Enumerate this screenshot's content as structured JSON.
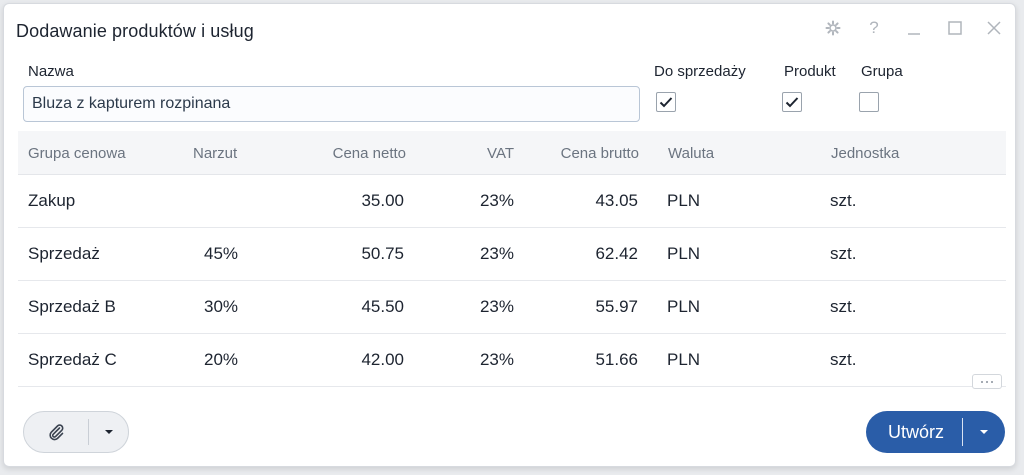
{
  "dialog": {
    "title": "Dodawanie produktów i usług"
  },
  "window_controls": {
    "icons": [
      "gear-icon",
      "help-icon",
      "minimize-icon",
      "maximize-icon",
      "close-icon"
    ],
    "help_glyph": "?"
  },
  "form": {
    "name_label": "Nazwa",
    "name_value": "Bluza z kapturem rozpinana",
    "checkboxes": [
      {
        "label": "Do sprzedaży",
        "checked": true
      },
      {
        "label": "Produkt",
        "checked": true
      },
      {
        "label": "Grupa",
        "checked": false
      }
    ]
  },
  "table": {
    "headers": [
      "Grupa cenowa",
      "Narzut",
      "Cena netto",
      "VAT",
      "Cena brutto",
      "Waluta",
      "Jednostka"
    ],
    "rows": [
      {
        "grupa": "Zakup",
        "narzut": "",
        "netto": "35.00",
        "vat": "23%",
        "brutto": "43.05",
        "waluta": "PLN",
        "jednostka": "szt."
      },
      {
        "grupa": "Sprzedaż",
        "narzut": "45%",
        "netto": "50.75",
        "vat": "23%",
        "brutto": "62.42",
        "waluta": "PLN",
        "jednostka": "szt."
      },
      {
        "grupa": "Sprzedaż B",
        "narzut": "30%",
        "netto": "45.50",
        "vat": "23%",
        "brutto": "55.97",
        "waluta": "PLN",
        "jednostka": "szt."
      },
      {
        "grupa": "Sprzedaż C",
        "narzut": "20%",
        "netto": "42.00",
        "vat": "23%",
        "brutto": "51.66",
        "waluta": "PLN",
        "jednostka": "szt."
      }
    ]
  },
  "footer": {
    "attach_icon": "paperclip-icon",
    "create_label": "Utwórz"
  },
  "colors": {
    "primary": "#2a5da8",
    "border": "#b9c6d6",
    "header_bg": "#f5f6f8"
  }
}
